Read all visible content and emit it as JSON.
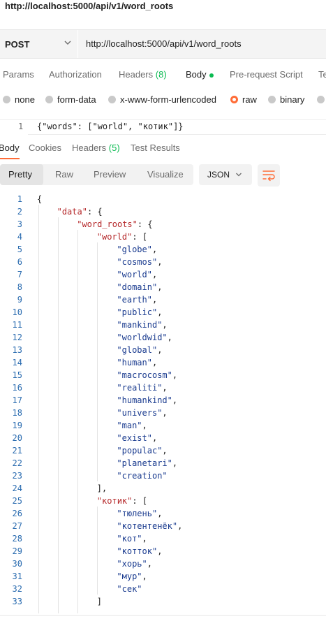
{
  "request": {
    "title": "http://localhost:5000/api/v1/word_roots",
    "method": "POST",
    "url": "http://localhost:5000/api/v1/word_roots"
  },
  "request_tabs": [
    {
      "label": "Params"
    },
    {
      "label": "Authorization"
    },
    {
      "label": "Headers",
      "count": "(8)"
    },
    {
      "label": "Body",
      "active": true
    },
    {
      "label": "Pre-request Script"
    },
    {
      "label": "Te"
    }
  ],
  "body_types": [
    {
      "label": "none"
    },
    {
      "label": "form-data"
    },
    {
      "label": "x-www-form-urlencoded"
    },
    {
      "label": "raw",
      "selected": true
    },
    {
      "label": "binary"
    }
  ],
  "request_body": {
    "line_number": "1",
    "code": "{\"words\": [\"world\", \"котик\"]}"
  },
  "response_tabs": [
    {
      "label": "Body",
      "active": true
    },
    {
      "label": "Cookies"
    },
    {
      "label": "Headers",
      "count": "(5)"
    },
    {
      "label": "Test Results"
    }
  ],
  "view_modes": [
    {
      "label": "Pretty",
      "active": true
    },
    {
      "label": "Raw"
    },
    {
      "label": "Preview"
    },
    {
      "label": "Visualize"
    }
  ],
  "format_select": {
    "value": "JSON"
  },
  "colors": {
    "accent": "#ff6c37",
    "count_green": "#0cbb52",
    "json_key": "#b5282a",
    "json_string": "#1a3b8f",
    "line_number": "#2b6cb0"
  },
  "response_body": {
    "lines": [
      {
        "n": "1",
        "indent": 0,
        "parts": [
          {
            "t": "{",
            "c": "p"
          }
        ]
      },
      {
        "n": "2",
        "indent": 1,
        "parts": [
          {
            "t": "\"data\"",
            "c": "k"
          },
          {
            "t": ": {",
            "c": "p"
          }
        ]
      },
      {
        "n": "3",
        "indent": 2,
        "parts": [
          {
            "t": "\"word_roots\"",
            "c": "k"
          },
          {
            "t": ": {",
            "c": "p"
          }
        ]
      },
      {
        "n": "4",
        "indent": 3,
        "parts": [
          {
            "t": "\"world\"",
            "c": "k"
          },
          {
            "t": ": [",
            "c": "p"
          }
        ]
      },
      {
        "n": "5",
        "indent": 4,
        "parts": [
          {
            "t": "\"globe\"",
            "c": "s"
          },
          {
            "t": ",",
            "c": "p"
          }
        ]
      },
      {
        "n": "6",
        "indent": 4,
        "parts": [
          {
            "t": "\"cosmos\"",
            "c": "s"
          },
          {
            "t": ",",
            "c": "p"
          }
        ]
      },
      {
        "n": "7",
        "indent": 4,
        "parts": [
          {
            "t": "\"world\"",
            "c": "s"
          },
          {
            "t": ",",
            "c": "p"
          }
        ]
      },
      {
        "n": "8",
        "indent": 4,
        "parts": [
          {
            "t": "\"domain\"",
            "c": "s"
          },
          {
            "t": ",",
            "c": "p"
          }
        ]
      },
      {
        "n": "9",
        "indent": 4,
        "parts": [
          {
            "t": "\"earth\"",
            "c": "s"
          },
          {
            "t": ",",
            "c": "p"
          }
        ]
      },
      {
        "n": "10",
        "indent": 4,
        "parts": [
          {
            "t": "\"public\"",
            "c": "s"
          },
          {
            "t": ",",
            "c": "p"
          }
        ]
      },
      {
        "n": "11",
        "indent": 4,
        "parts": [
          {
            "t": "\"mankind\"",
            "c": "s"
          },
          {
            "t": ",",
            "c": "p"
          }
        ]
      },
      {
        "n": "12",
        "indent": 4,
        "parts": [
          {
            "t": "\"worldwid\"",
            "c": "s"
          },
          {
            "t": ",",
            "c": "p"
          }
        ]
      },
      {
        "n": "13",
        "indent": 4,
        "parts": [
          {
            "t": "\"global\"",
            "c": "s"
          },
          {
            "t": ",",
            "c": "p"
          }
        ]
      },
      {
        "n": "14",
        "indent": 4,
        "parts": [
          {
            "t": "\"human\"",
            "c": "s"
          },
          {
            "t": ",",
            "c": "p"
          }
        ]
      },
      {
        "n": "15",
        "indent": 4,
        "parts": [
          {
            "t": "\"macrocosm\"",
            "c": "s"
          },
          {
            "t": ",",
            "c": "p"
          }
        ]
      },
      {
        "n": "16",
        "indent": 4,
        "parts": [
          {
            "t": "\"realiti\"",
            "c": "s"
          },
          {
            "t": ",",
            "c": "p"
          }
        ]
      },
      {
        "n": "17",
        "indent": 4,
        "parts": [
          {
            "t": "\"humankind\"",
            "c": "s"
          },
          {
            "t": ",",
            "c": "p"
          }
        ]
      },
      {
        "n": "18",
        "indent": 4,
        "parts": [
          {
            "t": "\"univers\"",
            "c": "s"
          },
          {
            "t": ",",
            "c": "p"
          }
        ]
      },
      {
        "n": "19",
        "indent": 4,
        "parts": [
          {
            "t": "\"man\"",
            "c": "s"
          },
          {
            "t": ",",
            "c": "p"
          }
        ]
      },
      {
        "n": "20",
        "indent": 4,
        "parts": [
          {
            "t": "\"exist\"",
            "c": "s"
          },
          {
            "t": ",",
            "c": "p"
          }
        ]
      },
      {
        "n": "21",
        "indent": 4,
        "parts": [
          {
            "t": "\"populac\"",
            "c": "s"
          },
          {
            "t": ",",
            "c": "p"
          }
        ]
      },
      {
        "n": "22",
        "indent": 4,
        "parts": [
          {
            "t": "\"planetari\"",
            "c": "s"
          },
          {
            "t": ",",
            "c": "p"
          }
        ]
      },
      {
        "n": "23",
        "indent": 4,
        "parts": [
          {
            "t": "\"creation\"",
            "c": "s"
          }
        ]
      },
      {
        "n": "24",
        "indent": 3,
        "parts": [
          {
            "t": "],",
            "c": "p"
          }
        ]
      },
      {
        "n": "25",
        "indent": 3,
        "parts": [
          {
            "t": "\"котик\"",
            "c": "k"
          },
          {
            "t": ": [",
            "c": "p"
          }
        ]
      },
      {
        "n": "26",
        "indent": 4,
        "parts": [
          {
            "t": "\"тюлень\"",
            "c": "s"
          },
          {
            "t": ",",
            "c": "p"
          }
        ]
      },
      {
        "n": "27",
        "indent": 4,
        "parts": [
          {
            "t": "\"котентенёк\"",
            "c": "s"
          },
          {
            "t": ",",
            "c": "p"
          }
        ]
      },
      {
        "n": "28",
        "indent": 4,
        "parts": [
          {
            "t": "\"кот\"",
            "c": "s"
          },
          {
            "t": ",",
            "c": "p"
          }
        ]
      },
      {
        "n": "29",
        "indent": 4,
        "parts": [
          {
            "t": "\"котток\"",
            "c": "s"
          },
          {
            "t": ",",
            "c": "p"
          }
        ]
      },
      {
        "n": "30",
        "indent": 4,
        "parts": [
          {
            "t": "\"хорь\"",
            "c": "s"
          },
          {
            "t": ",",
            "c": "p"
          }
        ]
      },
      {
        "n": "31",
        "indent": 4,
        "parts": [
          {
            "t": "\"мур\"",
            "c": "s"
          },
          {
            "t": ",",
            "c": "p"
          }
        ]
      },
      {
        "n": "32",
        "indent": 4,
        "parts": [
          {
            "t": "\"сек\"",
            "c": "s"
          }
        ]
      },
      {
        "n": "33",
        "indent": 3,
        "parts": [
          {
            "t": "]",
            "c": "p"
          }
        ]
      }
    ]
  }
}
